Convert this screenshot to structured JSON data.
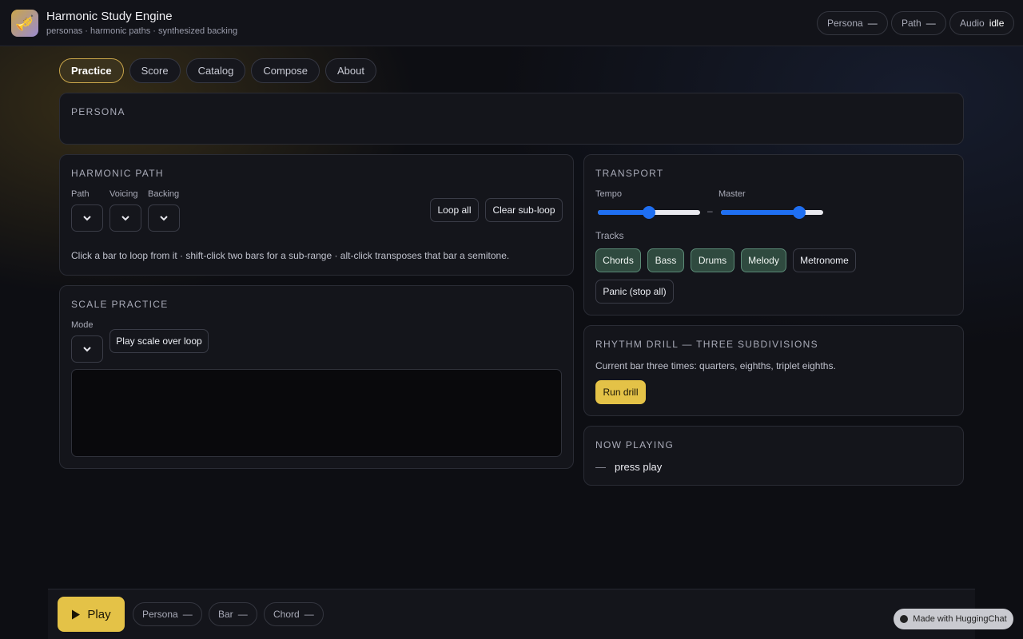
{
  "header": {
    "title": "Harmonic Study Engine",
    "subtitle": "personas · harmonic paths · synthesized backing",
    "logo_icon": "trumpet-icon",
    "status": [
      {
        "label": "Persona",
        "value": "—"
      },
      {
        "label": "Path",
        "value": "—"
      },
      {
        "label": "Audio",
        "value": "idle"
      }
    ]
  },
  "tabs": [
    {
      "label": "Practice",
      "active": true
    },
    {
      "label": "Score"
    },
    {
      "label": "Catalog"
    },
    {
      "label": "Compose"
    },
    {
      "label": "About"
    }
  ],
  "persona": {
    "title": "Persona"
  },
  "harmonic_path": {
    "title": "Harmonic Path",
    "path_label": "Path",
    "voicing_label": "Voicing",
    "backing_label": "Backing",
    "loop_all_label": "Loop all",
    "clear_subloop_label": "Clear sub-loop",
    "hint": "Click a bar to loop from it · shift-click two bars for a sub-range · alt-click transposes that bar a semitone."
  },
  "scale_practice": {
    "title": "Scale Practice",
    "mode_label": "Mode",
    "play_label": "Play scale over loop"
  },
  "transport": {
    "title": "Transport",
    "tempo_label": "Tempo",
    "tempo_value": 0.5,
    "separator": "–",
    "master_label": "Master",
    "master_value": 0.8,
    "tracks_label": "Tracks",
    "tracks": [
      {
        "label": "Chords",
        "on": true
      },
      {
        "label": "Bass",
        "on": true
      },
      {
        "label": "Drums",
        "on": true
      },
      {
        "label": "Melody",
        "on": true
      },
      {
        "label": "Metronome",
        "on": false
      }
    ],
    "panic_label": "Panic (stop all)"
  },
  "rhythm": {
    "title": "Rhythm Drill — Three Subdivisions",
    "desc": "Current bar three times: quarters, eighths, triplet eighths.",
    "run_label": "Run drill"
  },
  "now_playing": {
    "title": "Now Playing",
    "dash": "—",
    "text": "press play"
  },
  "bottom": {
    "play_label": "Play",
    "pills": [
      {
        "label": "Persona",
        "value": "—"
      },
      {
        "label": "Bar",
        "value": "—"
      },
      {
        "label": "Chord",
        "value": "—"
      }
    ],
    "made_with": "Made with HuggingChat"
  },
  "colors": {
    "accent": "#e4c247",
    "track_on": "#2f4a3f",
    "slider": "#1f6ff2"
  }
}
